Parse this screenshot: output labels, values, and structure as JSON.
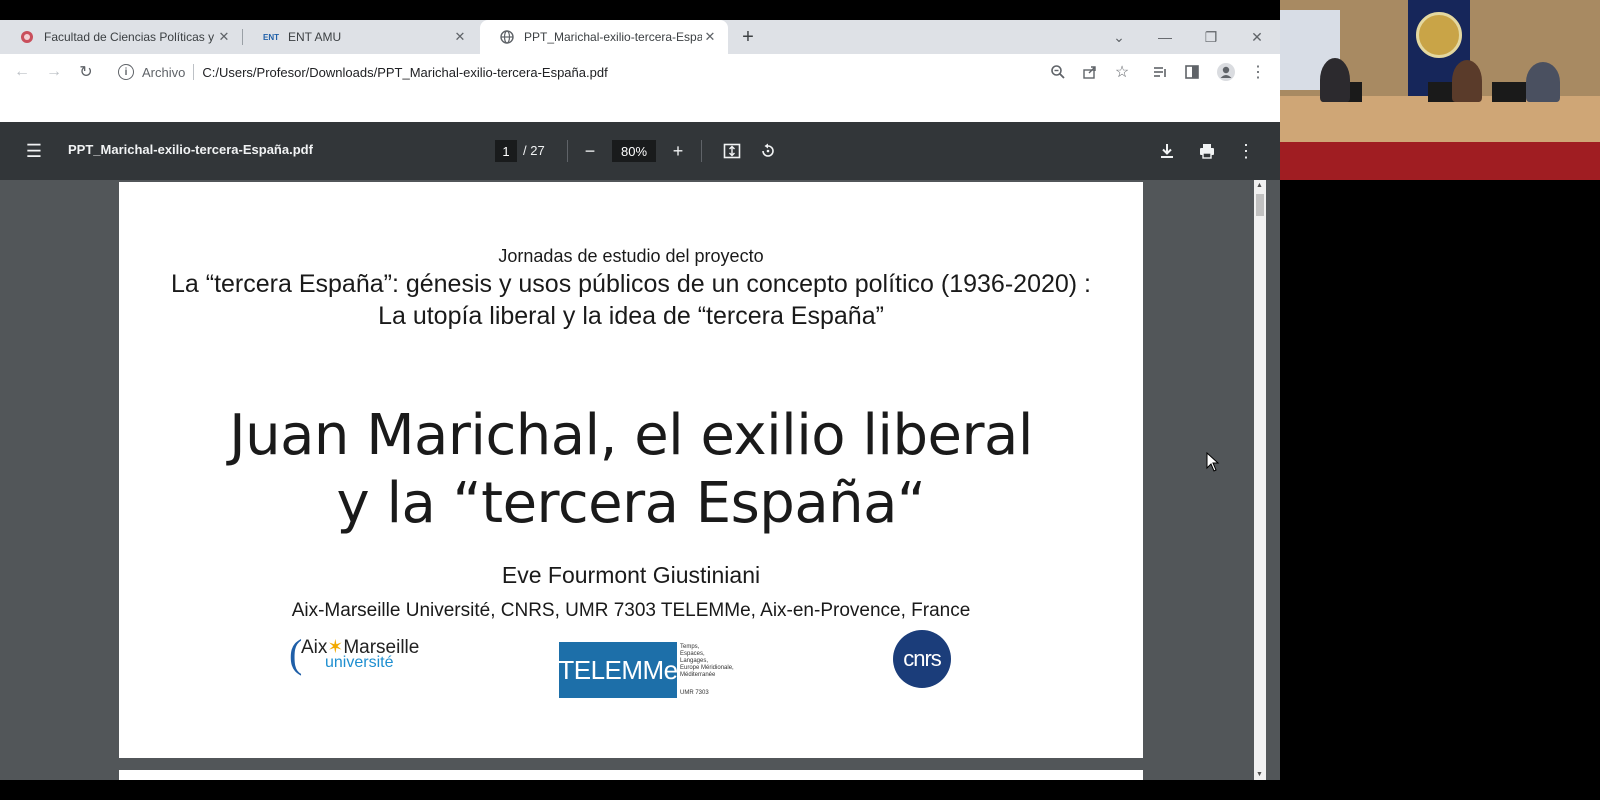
{
  "tabs": [
    {
      "label": "Facultad de Ciencias Políticas y S",
      "active": false
    },
    {
      "label": "ENT AMU",
      "active": false,
      "favicon_text": "ENT"
    },
    {
      "label": "PPT_Marichal-exilio-tercera-Espa",
      "active": true
    }
  ],
  "toolbar": {
    "chip": "Archivo",
    "url": "C:/Users/Profesor/Downloads/PPT_Marichal-exilio-tercera-España.pdf"
  },
  "pdf": {
    "filename": "PPT_Marichal-exilio-tercera-España.pdf",
    "current_page": "1",
    "total_pages": "/ 27",
    "zoom": "80%"
  },
  "slide": {
    "subtitle_line1": "Jornadas de estudio del proyecto",
    "subtitle_line2": "La “tercera España”: génesis y usos públicos de un concepto político (1936-2020) : La utopía liberal y la idea de “tercera España”",
    "title_line1": "Juan Marichal, el exilio liberal",
    "title_line2": "y la “tercera España“",
    "author": "Eve Fourmont Giustiniani",
    "affiliation": "Aix-Marseille Université, CNRS, UMR 7303 TELEMMe, Aix-en-Provence, France",
    "logo_amu_line1_a": "Aix",
    "logo_amu_star": "✶",
    "logo_amu_line1_b": "Marseille",
    "logo_amu_line2": "université",
    "logo_telemme": "TELEMMe",
    "logo_telemme_caption": "Temps,\nEspaces,\nLangages,\nEurope Méridionale,\nMéditerranée",
    "logo_telemme_umr": "UMR 7303",
    "logo_cnrs": "cnrs"
  },
  "colors": {
    "pdf_toolbar": "#323639",
    "pdf_background": "#525659",
    "tabstrip": "#dee1e6"
  }
}
